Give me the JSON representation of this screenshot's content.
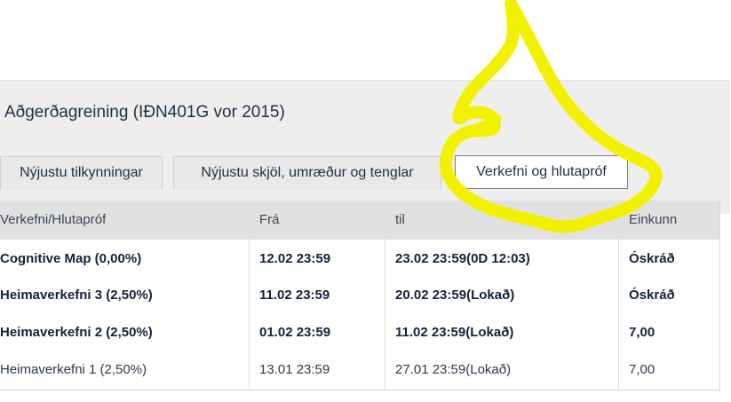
{
  "course": {
    "title": "Aðgerðagreining (IÐN401G vor 2015)"
  },
  "tabs": [
    {
      "label": "Nýjustu tilkynningar"
    },
    {
      "label": "Nýjustu skjöl, umræður og tenglar"
    },
    {
      "label": "Verkefni og hlutapróf"
    }
  ],
  "table": {
    "headers": [
      "Verkefni/Hlutapróf",
      "Frá",
      "til",
      "Einkunn"
    ],
    "rows": [
      {
        "name": "Cognitive Map (0,00%)",
        "from": "12.02 23:59",
        "to": "23.02 23:59(0D 12:03)",
        "grade": "Óskráð"
      },
      {
        "name": "Heimaverkefni 3 (2,50%)",
        "from": "11.02 23:59",
        "to": "20.02 23:59(Lokað)",
        "grade": "Óskráð"
      },
      {
        "name": "Heimaverkefni 2 (2,50%)",
        "from": "01.02 23:59",
        "to": "11.02 23:59(Lokað)",
        "grade": "7,00"
      },
      {
        "name": "Heimaverkefni 1 (2,50%)",
        "from": "13.01 23:59",
        "to": "27.01 23:59(Lokað)",
        "grade": "7,00"
      }
    ]
  },
  "colors": {
    "highlight": "#f2f200",
    "header_bg": "#e1e1e1",
    "panel_bg": "#eeeeee"
  }
}
